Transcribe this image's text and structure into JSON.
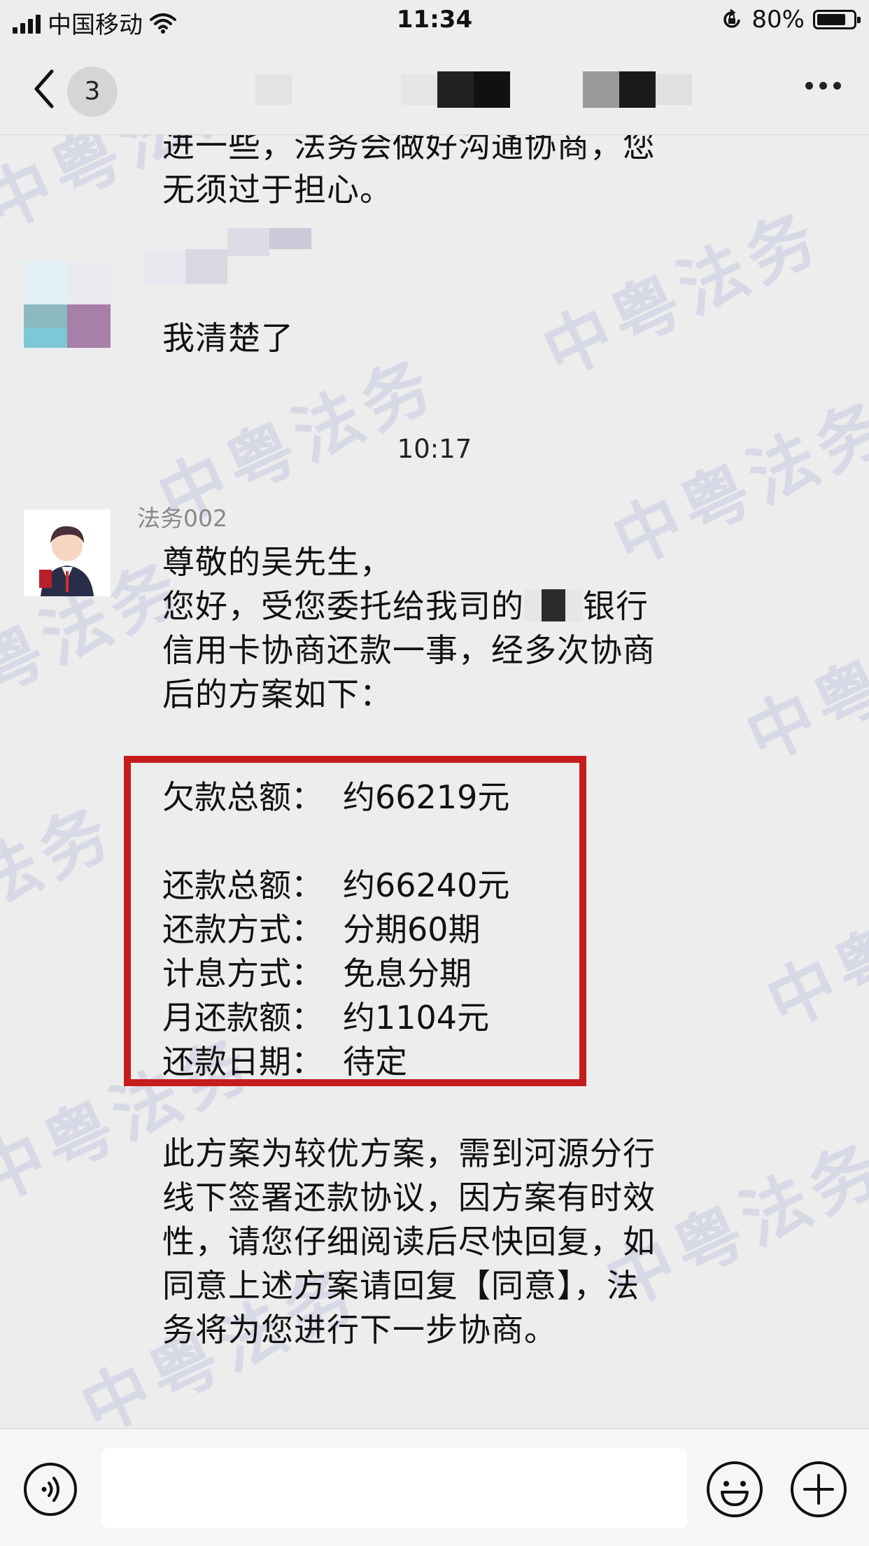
{
  "status_bar": {
    "carrier": "中国移动",
    "time": "11:34",
    "battery_text": "80%",
    "battery_level": 0.8,
    "icons": [
      "signal-icon",
      "wifi-icon",
      "rotation-lock-icon",
      "battery-icon"
    ]
  },
  "nav": {
    "back_count": "3",
    "more_icon": "ellipsis-icon"
  },
  "watermark": "中粤法务",
  "chat": {
    "messages": [
      {
        "text": "进一些，法务会做好沟通协商，您\n无须过于担心。"
      },
      {
        "text": "我清楚了"
      }
    ],
    "timestamp": "10:17",
    "sender": "法务002",
    "greeting": "尊敬的吴先生，\n您好，受您委托给我司的",
    "bank_suffix": "银行",
    "intro_rest": "信用卡协商还款一事，经多次协商\n后的方案如下：",
    "plan": [
      {
        "label": "欠款总额：",
        "value": "约66219元"
      },
      {
        "label": "还款总额：",
        "value": "约66240元"
      },
      {
        "label": "还款方式：",
        "value": "分期60期"
      },
      {
        "label": "计息方式：",
        "value": "免息分期"
      },
      {
        "label": "月还款额：",
        "value": "约1104元"
      },
      {
        "label": "还款日期：",
        "value": "待定"
      }
    ],
    "closing": "此方案为较优方案，需到河源分行\n线下签署还款协议，因方案有时效\n性，请您仔细阅读后尽快回复，如\n同意上述方案请回复【同意】，法\n务将为您进行下一步协商。"
  },
  "input_bar": {
    "placeholder": "",
    "icons": [
      "voice-icon",
      "emoji-icon",
      "plus-icon"
    ]
  }
}
